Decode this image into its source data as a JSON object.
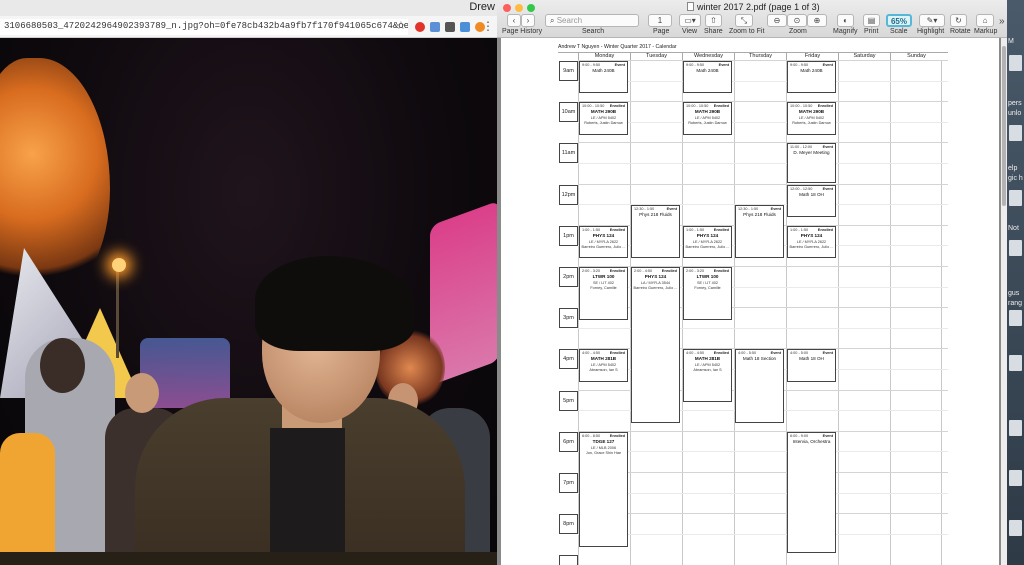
{
  "browser": {
    "profile_name": "Drew",
    "url": "3106680503_4720242964902393789_n.jpg?oh=0fe78cb432b4a9fb7f170f941065c674&oe=59177...",
    "photo_alt": "Night carnival photo"
  },
  "preview": {
    "window_title": "winter 2017 2.pdf (page 1 of 3)",
    "toolbar": {
      "page_history": "Page History",
      "search_placeholder": "Search",
      "search_label": "Search",
      "page_number": "1",
      "page_label": "Page",
      "view_label": "View",
      "share_label": "Share",
      "zoom_to_fit_label": "Zoom to Fit",
      "zoom_label": "Zoom",
      "magnify_label": "Magnify",
      "print_label": "Print",
      "scale_value": "65%",
      "scale_label": "Scale",
      "highlight_label": "Highlight",
      "rotate_label": "Rotate",
      "markup_label": "Markup",
      "overflow": "»"
    }
  },
  "calendar": {
    "title": "Andrew T Nguyen - Winter Quarter 2017 - Calendar",
    "days": [
      "Monday",
      "Tuesday",
      "Wednesday",
      "Thursday",
      "Friday",
      "Saturday",
      "Sunday"
    ],
    "times": [
      "9am",
      "10am",
      "11am",
      "12pm",
      "1pm",
      "2pm",
      "3pm",
      "4pm",
      "5pm",
      "6pm",
      "7pm",
      "8pm"
    ],
    "events": [
      {
        "day": 0,
        "start": 9.0,
        "end": 9.8333,
        "time": "9:00 - 9:50",
        "status": "Event",
        "title": "Math 240B",
        "bold": false,
        "lines": []
      },
      {
        "day": 2,
        "start": 9.0,
        "end": 9.8333,
        "time": "9:00 - 9:50",
        "status": "Event",
        "title": "Math 240B",
        "bold": false,
        "lines": []
      },
      {
        "day": 4,
        "start": 9.0,
        "end": 9.8333,
        "time": "9:00 - 9:50",
        "status": "Event",
        "title": "Math 240B",
        "bold": false,
        "lines": []
      },
      {
        "day": 0,
        "start": 10.0,
        "end": 10.8333,
        "time": "10:00 - 10:50",
        "status": "Enrolled",
        "title": "MATH 290B",
        "bold": true,
        "lines": [
          "LE / APM 5402",
          "Roberts, Justin Darrow"
        ]
      },
      {
        "day": 2,
        "start": 10.0,
        "end": 10.8333,
        "time": "10:00 - 10:50",
        "status": "Enrolled",
        "title": "MATH 290B",
        "bold": true,
        "lines": [
          "LE / APM 5402",
          "Roberts, Justin Darrow"
        ]
      },
      {
        "day": 4,
        "start": 10.0,
        "end": 10.8333,
        "time": "10:00 - 10:50",
        "status": "Enrolled",
        "title": "MATH 290B",
        "bold": true,
        "lines": [
          "LE / APM 5402",
          "Roberts, Justin Darrow"
        ]
      },
      {
        "day": 4,
        "start": 11.0,
        "end": 12.0,
        "time": "11:00 - 12:00",
        "status": "Event",
        "title": "D. Meyer Meeting",
        "bold": false,
        "lines": []
      },
      {
        "day": 4,
        "start": 12.0,
        "end": 12.8333,
        "time": "12:00 - 12:50",
        "status": "Event",
        "title": "Math 18 OH",
        "bold": false,
        "lines": []
      },
      {
        "day": 1,
        "start": 12.5,
        "end": 13.8333,
        "time": "12:30 - 1:50",
        "status": "Event",
        "title": "Phys 218 Fluids",
        "bold": false,
        "lines": []
      },
      {
        "day": 3,
        "start": 12.5,
        "end": 13.8333,
        "time": "12:30 - 1:50",
        "status": "Event",
        "title": "Phys 218 Fluids",
        "bold": false,
        "lines": []
      },
      {
        "day": 0,
        "start": 13.0,
        "end": 13.8333,
        "time": "1:00 - 1:50",
        "status": "Enrolled",
        "title": "PHYS 124",
        "bold": true,
        "lines": [
          "LE / MYR-A 2622",
          "Barreiro Guerrero, Julio ..."
        ]
      },
      {
        "day": 2,
        "start": 13.0,
        "end": 13.8333,
        "time": "1:00 - 1:50",
        "status": "Enrolled",
        "title": "PHYS 124",
        "bold": true,
        "lines": [
          "LE / MYR-A 2622",
          "Barreiro Guerrero, Julio ..."
        ]
      },
      {
        "day": 4,
        "start": 13.0,
        "end": 13.8333,
        "time": "1:00 - 1:50",
        "status": "Enrolled",
        "title": "PHYS 124",
        "bold": true,
        "lines": [
          "LE / MYR-A 2622",
          "Barreiro Guerrero, Julio ..."
        ]
      },
      {
        "day": 0,
        "start": 14.0,
        "end": 15.3333,
        "time": "2:00 - 3:20",
        "status": "Enrolled",
        "title": "LTWR 100",
        "bold": true,
        "lines": [
          "SE / LIT 402",
          "Forney, Camille"
        ]
      },
      {
        "day": 2,
        "start": 14.0,
        "end": 15.3333,
        "time": "2:00 - 3:20",
        "status": "Enrolled",
        "title": "LTWR 100",
        "bold": true,
        "lines": [
          "SE / LIT 402",
          "Forney, Camille"
        ]
      },
      {
        "day": 1,
        "start": 14.0,
        "end": 17.8333,
        "time": "2:00 - 4:50",
        "status": "Enrolled",
        "title": "PHYS 124",
        "bold": true,
        "lines": [
          "LA / MYR-A 3544",
          "Barreiro Guerrero, Julio ..."
        ]
      },
      {
        "day": 0,
        "start": 16.0,
        "end": 16.8333,
        "time": "4:00 - 4:50",
        "status": "Enrolled",
        "title": "MATH 281B",
        "bold": true,
        "lines": [
          "LE / APM 5402",
          "Abramson, Ian S"
        ]
      },
      {
        "day": 2,
        "start": 16.0,
        "end": 17.3333,
        "time": "4:00 - 4:50",
        "status": "Enrolled",
        "title": "MATH 281B",
        "bold": true,
        "lines": [
          "LE / APM 5402",
          "Abramson, Ian S"
        ]
      },
      {
        "day": 3,
        "start": 16.0,
        "end": 17.8333,
        "time": "4:00 - 5:50",
        "status": "Event",
        "title": "Math 18 Section",
        "bold": false,
        "lines": []
      },
      {
        "day": 4,
        "start": 16.0,
        "end": 16.8333,
        "time": "4:00 - 5:00",
        "status": "Event",
        "title": "Math 18 OH",
        "bold": false,
        "lines": []
      },
      {
        "day": 0,
        "start": 18.0,
        "end": 20.8333,
        "time": "6:00 - 8:50",
        "status": "Enrolled",
        "title": "TDGE 127",
        "bold": true,
        "lines": [
          "LE / MLB 2006",
          "Jun, Grace Shin Hae"
        ]
      },
      {
        "day": 4,
        "start": 18.0,
        "end": 21.0,
        "time": "6:00 - 9:00",
        "status": "Event",
        "title": "Intervia, Orchestra",
        "bold": false,
        "lines": []
      }
    ]
  },
  "desktop": {
    "labels": [
      "M",
      "pers",
      "unlo",
      "elp",
      "gic h",
      "Not",
      "gus",
      "rang"
    ]
  },
  "colors": {
    "scale_accent": "#56b8d6",
    "traffic_close": "#fc605c",
    "traffic_min": "#fdbc40",
    "traffic_max": "#34c84a"
  }
}
